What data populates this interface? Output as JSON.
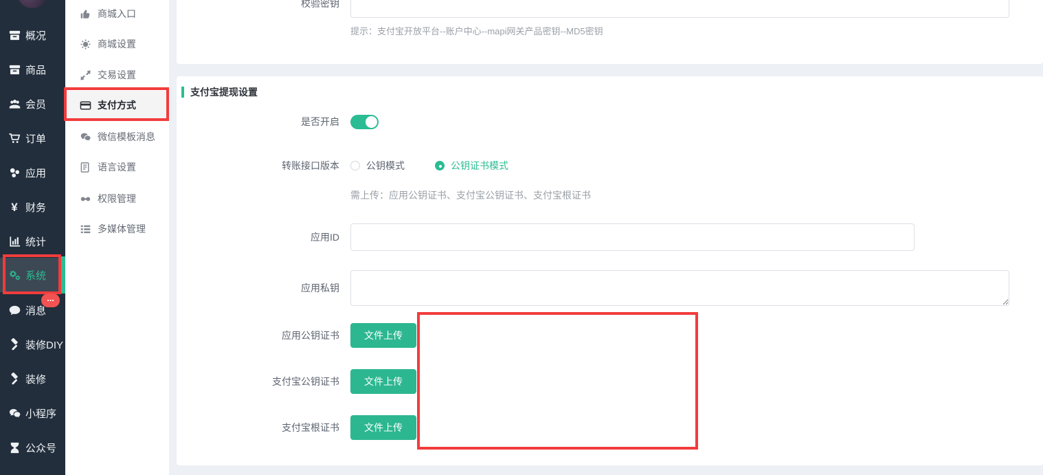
{
  "colors": {
    "accent_green": "#2bbc93",
    "button_green": "#2cb791",
    "annotation_red": "#f23c3c",
    "badge_red": "#f15353",
    "sidebar_bg": "#222e3c",
    "sidebar_active_bg": "#3c4854",
    "page_bg": "#edf0f5"
  },
  "sidebar": {
    "items": [
      {
        "label": "概况",
        "icon": "overview-icon",
        "active": false
      },
      {
        "label": "商品",
        "icon": "goods-icon",
        "active": false
      },
      {
        "label": "会员",
        "icon": "members-icon",
        "active": false
      },
      {
        "label": "订单",
        "icon": "orders-icon",
        "active": false
      },
      {
        "label": "应用",
        "icon": "apps-icon",
        "active": false
      },
      {
        "label": "财务",
        "icon": "finance-icon",
        "active": false
      },
      {
        "label": "统计",
        "icon": "stats-icon",
        "active": false
      },
      {
        "label": "系统",
        "icon": "system-icon",
        "active": true
      },
      {
        "label": "消息",
        "icon": "message-icon",
        "active": false,
        "badge": "..."
      },
      {
        "label": "装修DIY",
        "icon": "diy-icon",
        "active": false
      },
      {
        "label": "装修",
        "icon": "fitment-icon",
        "active": false
      },
      {
        "label": "小程序",
        "icon": "miniprogram-icon",
        "active": false
      },
      {
        "label": "公众号",
        "icon": "official-account-icon",
        "active": false
      }
    ]
  },
  "submenu": {
    "items": [
      {
        "label": "商城入口",
        "icon": "shop-entry-icon",
        "active": false
      },
      {
        "label": "商城设置",
        "icon": "shop-settings-icon",
        "active": false
      },
      {
        "label": "交易设置",
        "icon": "trade-settings-icon",
        "active": false
      },
      {
        "label": "支付方式",
        "icon": "payment-method-icon",
        "active": true
      },
      {
        "label": "微信模板消息",
        "icon": "wechat-template-icon",
        "active": false
      },
      {
        "label": "语言设置",
        "icon": "language-settings-icon",
        "active": false
      },
      {
        "label": "权限管理",
        "icon": "permission-icon",
        "active": false
      },
      {
        "label": "多媒体管理",
        "icon": "media-manage-icon",
        "active": false
      }
    ]
  },
  "form_top": {
    "label": "校验密钥",
    "value": "",
    "hint": "提示：支付宝开放平台--账户中心--mapi网关产品密钥--MD5密钥"
  },
  "alipay_section": {
    "title": "支付宝提现设置",
    "enable_label": "是否开启",
    "enable_state": "on",
    "version_label": "转账接口版本",
    "version_options": [
      {
        "label": "公钥模式",
        "selected": false
      },
      {
        "label": "公钥证书模式",
        "selected": true
      }
    ],
    "version_hint": "需上传：应用公钥证书、支付宝公钥证书、支付宝根证书",
    "app_id_label": "应用ID",
    "app_id_value": "",
    "private_key_label": "应用私钥",
    "private_key_value": "",
    "uploads": [
      {
        "label": "应用公钥证书",
        "button": "文件上传"
      },
      {
        "label": "支付宝公钥证书",
        "button": "文件上传"
      },
      {
        "label": "支付宝根证书",
        "button": "文件上传"
      }
    ]
  }
}
